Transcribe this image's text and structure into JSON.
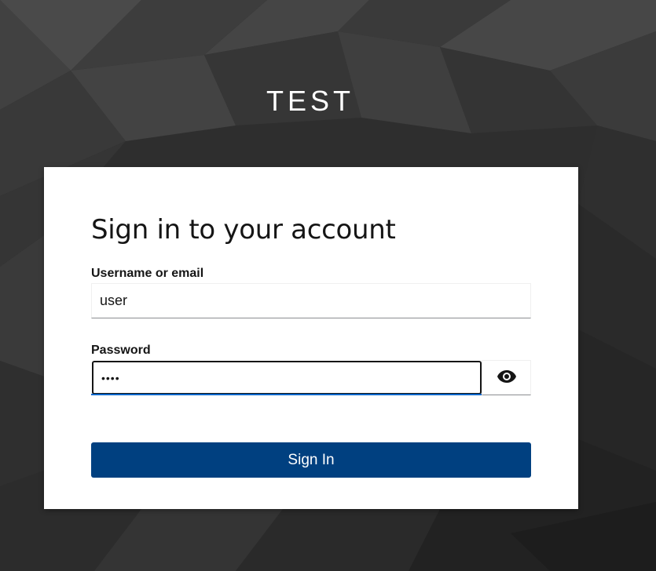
{
  "realm": {
    "title": "TEST"
  },
  "login_form": {
    "heading": "Sign in to your account",
    "username": {
      "label": "Username or email",
      "value": "user"
    },
    "password": {
      "label": "Password",
      "value": "pass",
      "reveal_icon": "eye-icon"
    },
    "submit_label": "Sign In"
  },
  "colors": {
    "primary_button": "#004080",
    "focus_underline": "#0066cc",
    "background": "#2b2b2b",
    "card": "#ffffff"
  }
}
